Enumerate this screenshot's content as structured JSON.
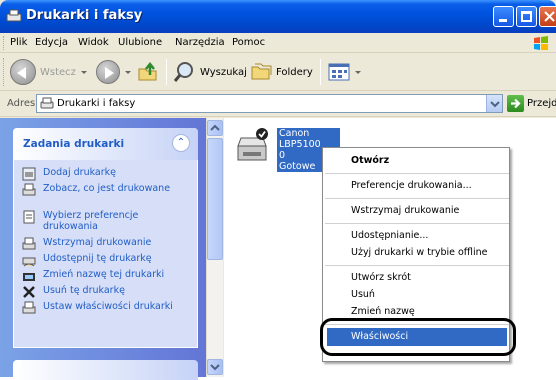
{
  "window": {
    "title": "Drukarki i faksy"
  },
  "menu": [
    "Plik",
    "Edycja",
    "Widok",
    "Ulubione",
    "Narzędzia",
    "Pomoc"
  ],
  "toolbar": {
    "back": "Wstecz",
    "search": "Wyszukaj",
    "folders": "Foldery"
  },
  "address": {
    "label": "Adres",
    "value": "Drukarki i faksy",
    "go": "Przejdź"
  },
  "tasks": {
    "title": "Zadania drukarki",
    "items": [
      {
        "label": "Dodaj drukarkę",
        "icon": "add-printer-icon"
      },
      {
        "label": "Zobacz, co jest drukowane",
        "icon": "print-queue-icon"
      },
      {
        "label": "Wybierz preferencje drukowania",
        "icon": "preferences-icon"
      },
      {
        "label": "Wstrzymaj drukowanie",
        "icon": "pause-printing-icon"
      },
      {
        "label": "Udostępnij tę drukarkę",
        "icon": "share-printer-icon"
      },
      {
        "label": "Zmień nazwę tej drukarki",
        "icon": "rename-icon"
      },
      {
        "label": "Usuń tę drukarkę",
        "icon": "delete-icon"
      },
      {
        "label": "Ustaw właściwości drukarki",
        "icon": "properties-icon"
      }
    ]
  },
  "printer": {
    "name": "Canon LBP5100",
    "docs": "0",
    "status": "Gotowe"
  },
  "context_menu": [
    "Otwórz",
    "Preferencje drukowania...",
    "Wstrzymaj drukowanie",
    "Udostępnianie...",
    "Użyj drukarki w trybie offline",
    "Utwórz skrót",
    "Usuń",
    "Zmień nazwę",
    "Właściwości"
  ],
  "colors": {
    "title_bar": "#0053e0",
    "selection": "#316ac5",
    "task_text": "#215dc6"
  }
}
